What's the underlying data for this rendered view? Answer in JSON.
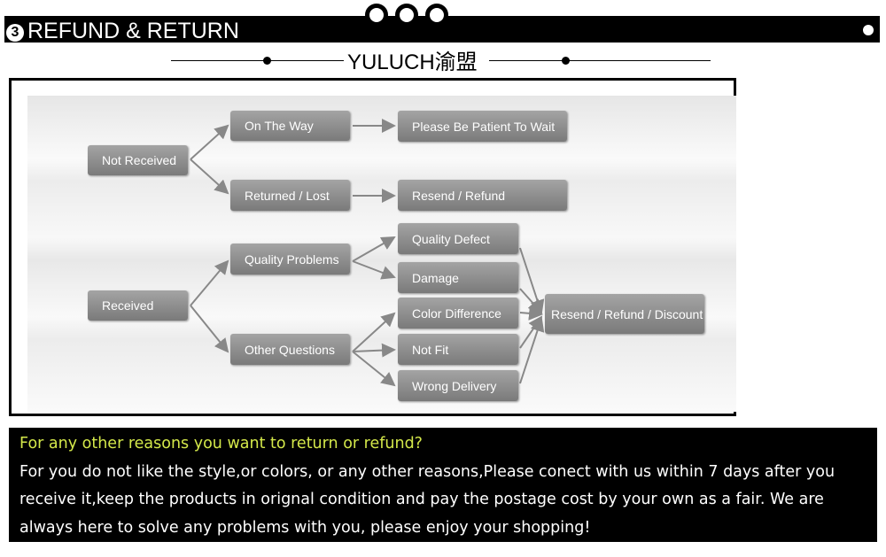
{
  "header": {
    "step_number": "3",
    "title": "REFUND & RETURN"
  },
  "brand": "YULUCH渝盟",
  "diagram": {
    "not_received": "Not Received",
    "on_the_way": "On The Way",
    "patient": "Please Be Patient To Wait",
    "returned_lost": "Returned / Lost",
    "resend_refund": "Resend / Refund",
    "received": "Received",
    "quality_problems": "Quality Problems",
    "other_questions": "Other Questions",
    "quality_defect": "Quality Defect",
    "damage": "Damage",
    "color_difference": "Color Difference",
    "not_fit": "Not Fit",
    "wrong_delivery": "Wrong Delivery",
    "resend_refund_discount": "Resend / Refund / Discount"
  },
  "notice": {
    "question": "For any other reasons you want to return or refund?",
    "body": "For you do not like the style,or colors, or any other reasons,Please conect with us within 7 days after you receive it,keep the products in orignal condition and pay the postage cost by your own as a fair. We are always here to solve any problems with you, please enjoy your shopping!"
  },
  "colors": {
    "accent_question": "#d4e84a",
    "box": "#8a8a8a"
  }
}
